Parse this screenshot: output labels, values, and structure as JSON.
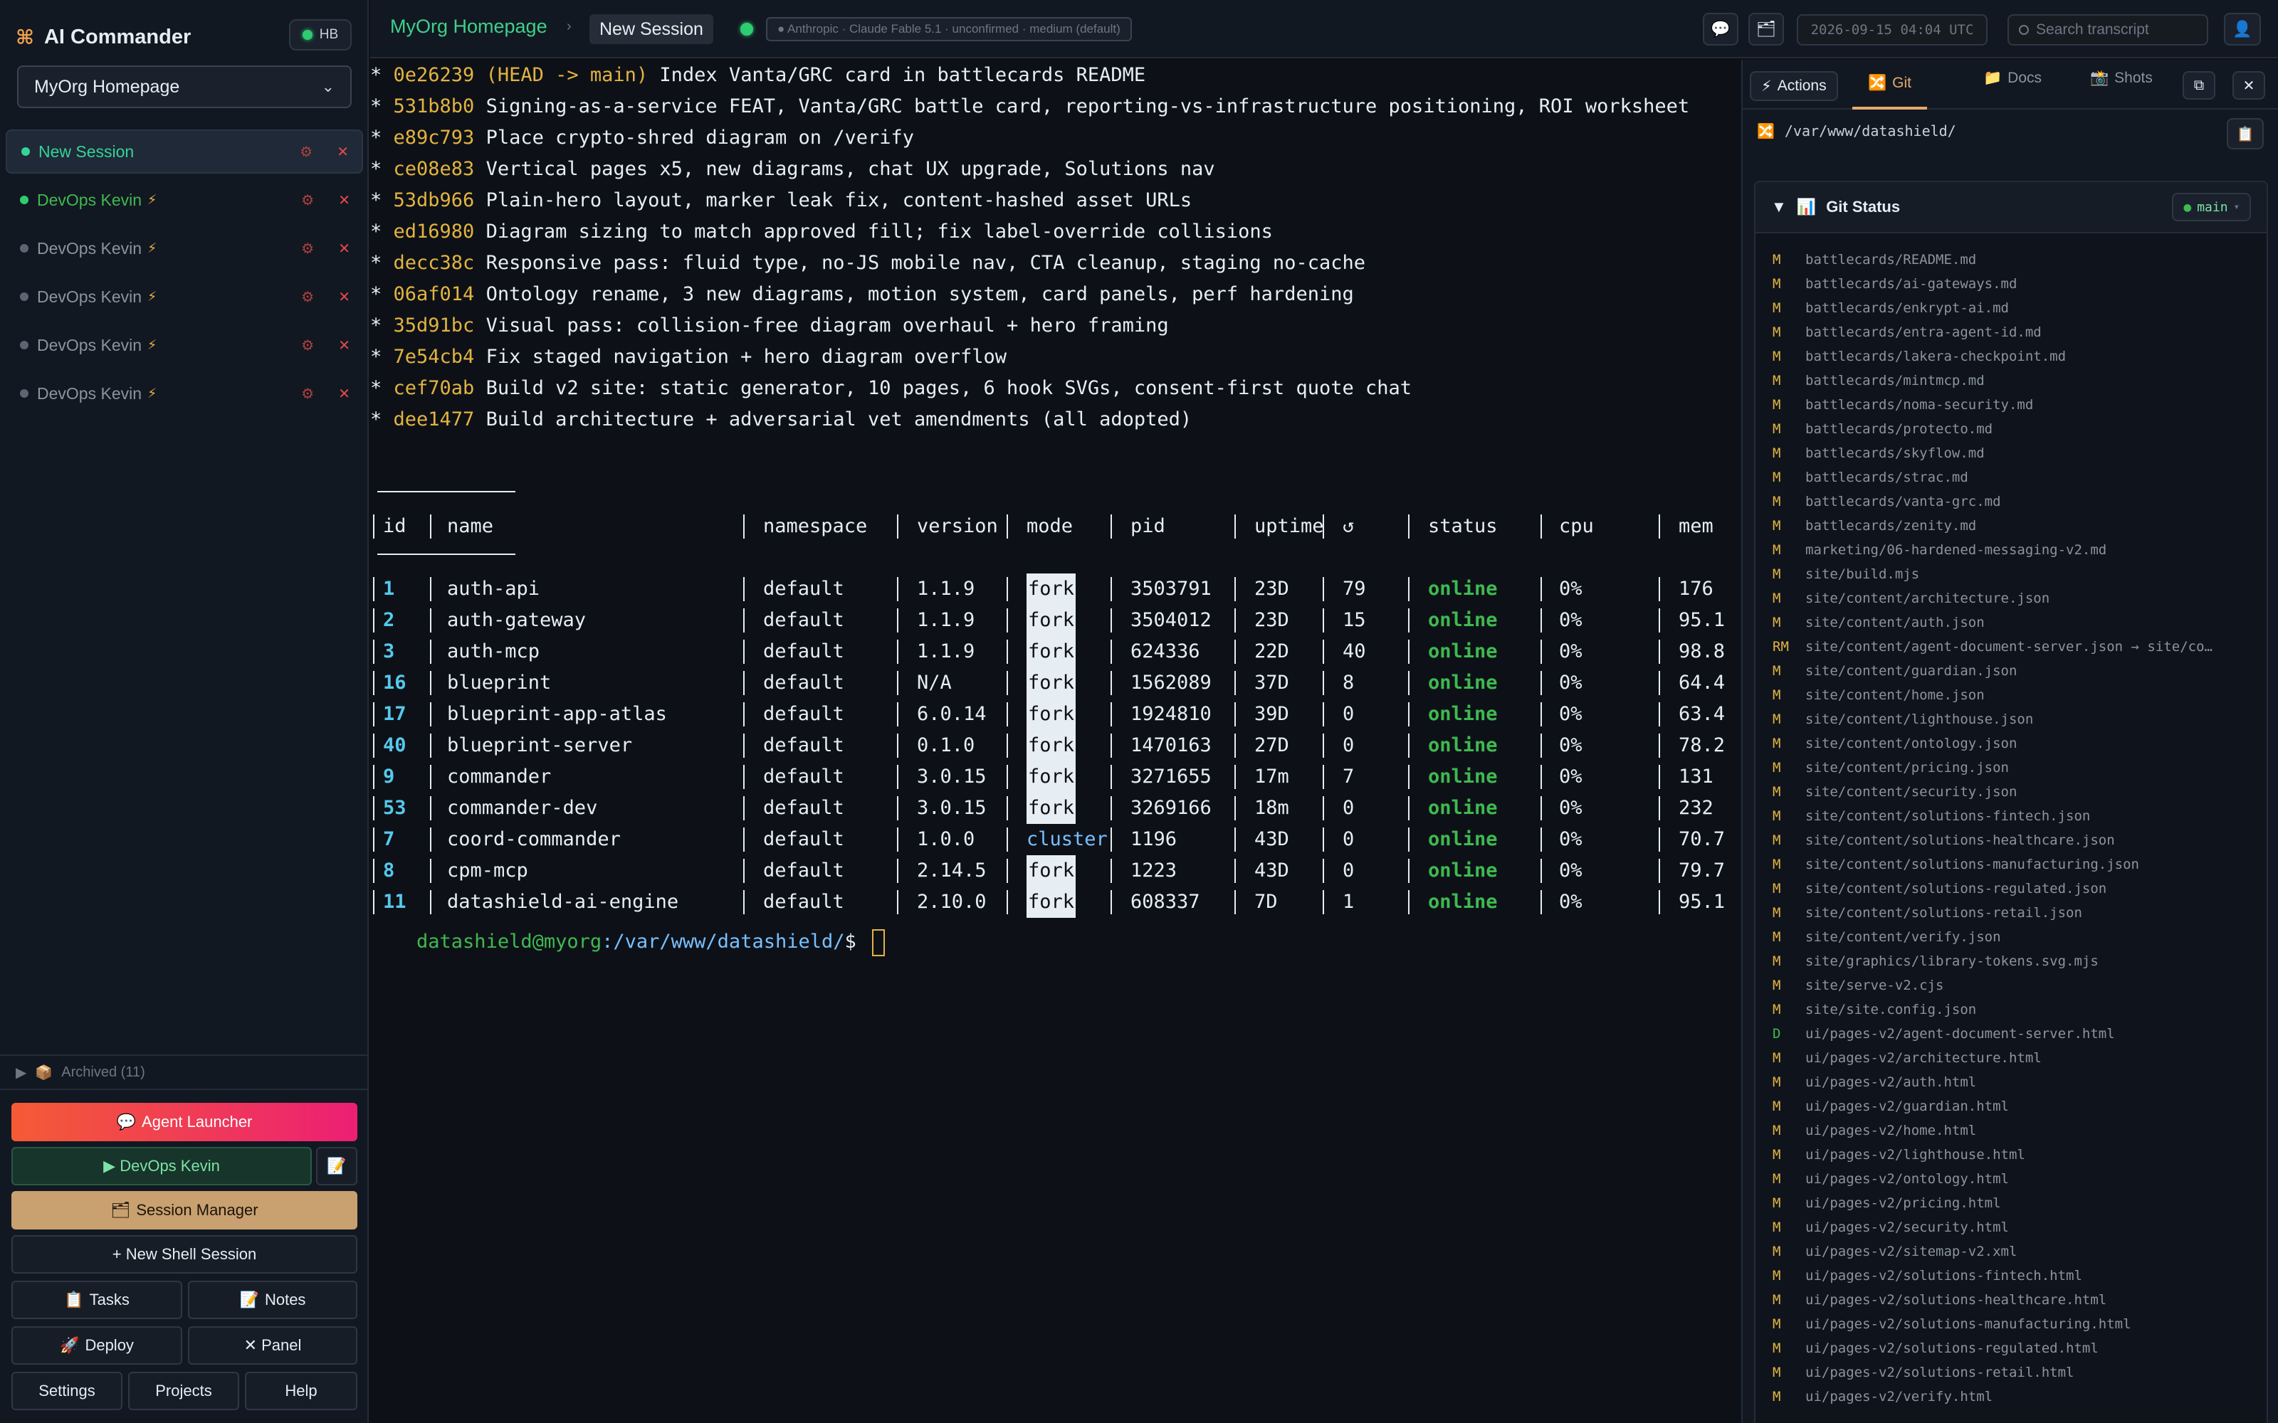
{
  "app": {
    "title": "AI Commander",
    "hb_label": "HB",
    "project_selected": "MyOrg Homepage"
  },
  "sessions": [
    {
      "name": "New Session",
      "active": true
    },
    {
      "name": "DevOps Kevin",
      "running": true
    },
    {
      "name": "DevOps Kevin"
    },
    {
      "name": "DevOps Kevin"
    },
    {
      "name": "DevOps Kevin"
    },
    {
      "name": "DevOps Kevin"
    }
  ],
  "archived_label": "Archived (11)",
  "buttons": {
    "agent_launcher": "Agent Launcher",
    "devops_kevin": "▶ DevOps Kevin",
    "session_manager": "Session Manager",
    "new_shell": "+ New Shell Session",
    "tasks": "Tasks",
    "notes": "Notes",
    "deploy": "Deploy",
    "panel": "✕ Panel",
    "settings": "Settings",
    "projects": "Projects",
    "help": "Help"
  },
  "topbar": {
    "breadcrumb_project": "MyOrg Homepage",
    "breadcrumb_session": "New Session",
    "model": "● Anthropic · Claude Fable 5.1 · unconfirmed · medium (default)",
    "datetime": "2026-09-15 04:04 UTC",
    "search_placeholder": "Search transcript"
  },
  "git_log": [
    {
      "hash": "0e26239",
      "ref": " (HEAD -> main)",
      "msg": " Index Vanta/GRC card in battlecards README"
    },
    {
      "hash": "531b8b0",
      "ref": "",
      "msg": " Signing-as-a-service FEAT, Vanta/GRC battle card, reporting-vs-infrastructure positioning, ROI worksheet"
    },
    {
      "hash": "e89c793",
      "ref": "",
      "msg": " Place crypto-shred diagram on /verify"
    },
    {
      "hash": "ce08e83",
      "ref": "",
      "msg": " Vertical pages x5, new diagrams, chat UX upgrade, Solutions nav"
    },
    {
      "hash": "53db966",
      "ref": "",
      "msg": " Plain-hero layout, marker leak fix, content-hashed asset URLs"
    },
    {
      "hash": "ed16980",
      "ref": "",
      "msg": " Diagram sizing to match approved fill; fix label-override collisions"
    },
    {
      "hash": "decc38c",
      "ref": "",
      "msg": " Responsive pass: fluid type, no-JS mobile nav, CTA cleanup, staging no-cache"
    },
    {
      "hash": "06af014",
      "ref": "",
      "msg": " Ontology rename, 3 new diagrams, motion system, card panels, perf hardening"
    },
    {
      "hash": "35d91bc",
      "ref": "",
      "msg": " Visual pass: collision-free diagram overhaul + hero framing"
    },
    {
      "hash": "7e54cb4",
      "ref": "",
      "msg": " Fix staged navigation + hero diagram overflow"
    },
    {
      "hash": "cef70ab",
      "ref": "",
      "msg": " Build v2 site: static generator, 10 pages, 6 hook SVGs, consent-first quote chat"
    },
    {
      "hash": "dee1477",
      "ref": "",
      "msg": " Build architecture + adversarial vet amendments (all adopted)"
    }
  ],
  "pm2": {
    "headers": [
      "id",
      "name",
      "namespace",
      "version",
      "mode",
      "pid",
      "uptime",
      "↺",
      "status",
      "cpu",
      "mem"
    ],
    "rows": [
      [
        "1",
        "auth-api",
        "default",
        "1.1.9",
        "fork",
        "3503791",
        "23D",
        "79",
        "online",
        "0%",
        "176"
      ],
      [
        "2",
        "auth-gateway",
        "default",
        "1.1.9",
        "fork",
        "3504012",
        "23D",
        "15",
        "online",
        "0%",
        "95.1"
      ],
      [
        "3",
        "auth-mcp",
        "default",
        "1.1.9",
        "fork",
        "624336",
        "22D",
        "40",
        "online",
        "0%",
        "98.8"
      ],
      [
        "16",
        "blueprint",
        "default",
        "N/A",
        "fork",
        "1562089",
        "37D",
        "8",
        "online",
        "0%",
        "64.4"
      ],
      [
        "17",
        "blueprint-app-atlas",
        "default",
        "6.0.14",
        "fork",
        "1924810",
        "39D",
        "0",
        "online",
        "0%",
        "63.4"
      ],
      [
        "40",
        "blueprint-server",
        "default",
        "0.1.0",
        "fork",
        "1470163",
        "27D",
        "0",
        "online",
        "0%",
        "78.2"
      ],
      [
        "9",
        "commander",
        "default",
        "3.0.15",
        "fork",
        "3271655",
        "17m",
        "7",
        "online",
        "0%",
        "131"
      ],
      [
        "53",
        "commander-dev",
        "default",
        "3.0.15",
        "fork",
        "3269166",
        "18m",
        "0",
        "online",
        "0%",
        "232"
      ],
      [
        "7",
        "coord-commander",
        "default",
        "1.0.0",
        "cluster",
        "1196",
        "43D",
        "0",
        "online",
        "0%",
        "70.7"
      ],
      [
        "8",
        "cpm-mcp",
        "default",
        "2.14.5",
        "fork",
        "1223",
        "43D",
        "0",
        "online",
        "0%",
        "79.7"
      ],
      [
        "11",
        "datashield-ai-engine",
        "default",
        "2.10.0",
        "fork",
        "608337",
        "7D",
        "1",
        "online",
        "0%",
        "95.1"
      ]
    ]
  },
  "prompt": {
    "user": "datashield@myorg",
    "path": ":/var/www/datashield/",
    "symbol": "$ "
  },
  "rpanel": {
    "tabs": {
      "actions": "Actions",
      "git": "Git",
      "docs": "Docs",
      "shots": "Shots"
    },
    "path": "/var/www/datashield/",
    "git_status_title": "Git Status",
    "branch": "main",
    "files": [
      [
        "M",
        "battlecards/README.md"
      ],
      [
        "M",
        "battlecards/ai-gateways.md"
      ],
      [
        "M",
        "battlecards/enkrypt-ai.md"
      ],
      [
        "M",
        "battlecards/entra-agent-id.md"
      ],
      [
        "M",
        "battlecards/lakera-checkpoint.md"
      ],
      [
        "M",
        "battlecards/mintmcp.md"
      ],
      [
        "M",
        "battlecards/noma-security.md"
      ],
      [
        "M",
        "battlecards/protecto.md"
      ],
      [
        "M",
        "battlecards/skyflow.md"
      ],
      [
        "M",
        "battlecards/strac.md"
      ],
      [
        "M",
        "battlecards/vanta-grc.md"
      ],
      [
        "M",
        "battlecards/zenity.md"
      ],
      [
        "M",
        "marketing/06-hardened-messaging-v2.md"
      ],
      [
        "M",
        "site/build.mjs"
      ],
      [
        "M",
        "site/content/architecture.json"
      ],
      [
        "M",
        "site/content/auth.json"
      ],
      [
        "RM",
        "site/content/agent-document-server.json → site/co…"
      ],
      [
        "M",
        "site/content/guardian.json"
      ],
      [
        "M",
        "site/content/home.json"
      ],
      [
        "M",
        "site/content/lighthouse.json"
      ],
      [
        "M",
        "site/content/ontology.json"
      ],
      [
        "M",
        "site/content/pricing.json"
      ],
      [
        "M",
        "site/content/security.json"
      ],
      [
        "M",
        "site/content/solutions-fintech.json"
      ],
      [
        "M",
        "site/content/solutions-healthcare.json"
      ],
      [
        "M",
        "site/content/solutions-manufacturing.json"
      ],
      [
        "M",
        "site/content/solutions-regulated.json"
      ],
      [
        "M",
        "site/content/solutions-retail.json"
      ],
      [
        "M",
        "site/content/verify.json"
      ],
      [
        "M",
        "site/graphics/library-tokens.svg.mjs"
      ],
      [
        "M",
        "site/serve-v2.cjs"
      ],
      [
        "M",
        "site/site.config.json"
      ],
      [
        "D",
        "ui/pages-v2/agent-document-server.html"
      ],
      [
        "M",
        "ui/pages-v2/architecture.html"
      ],
      [
        "M",
        "ui/pages-v2/auth.html"
      ],
      [
        "M",
        "ui/pages-v2/guardian.html"
      ],
      [
        "M",
        "ui/pages-v2/home.html"
      ],
      [
        "M",
        "ui/pages-v2/lighthouse.html"
      ],
      [
        "M",
        "ui/pages-v2/ontology.html"
      ],
      [
        "M",
        "ui/pages-v2/pricing.html"
      ],
      [
        "M",
        "ui/pages-v2/security.html"
      ],
      [
        "M",
        "ui/pages-v2/sitemap-v2.xml"
      ],
      [
        "M",
        "ui/pages-v2/solutions-fintech.html"
      ],
      [
        "M",
        "ui/pages-v2/solutions-healthcare.html"
      ],
      [
        "M",
        "ui/pages-v2/solutions-manufacturing.html"
      ],
      [
        "M",
        "ui/pages-v2/solutions-regulated.html"
      ],
      [
        "M",
        "ui/pages-v2/solutions-retail.html"
      ],
      [
        "M",
        "ui/pages-v2/verify.html"
      ]
    ]
  }
}
